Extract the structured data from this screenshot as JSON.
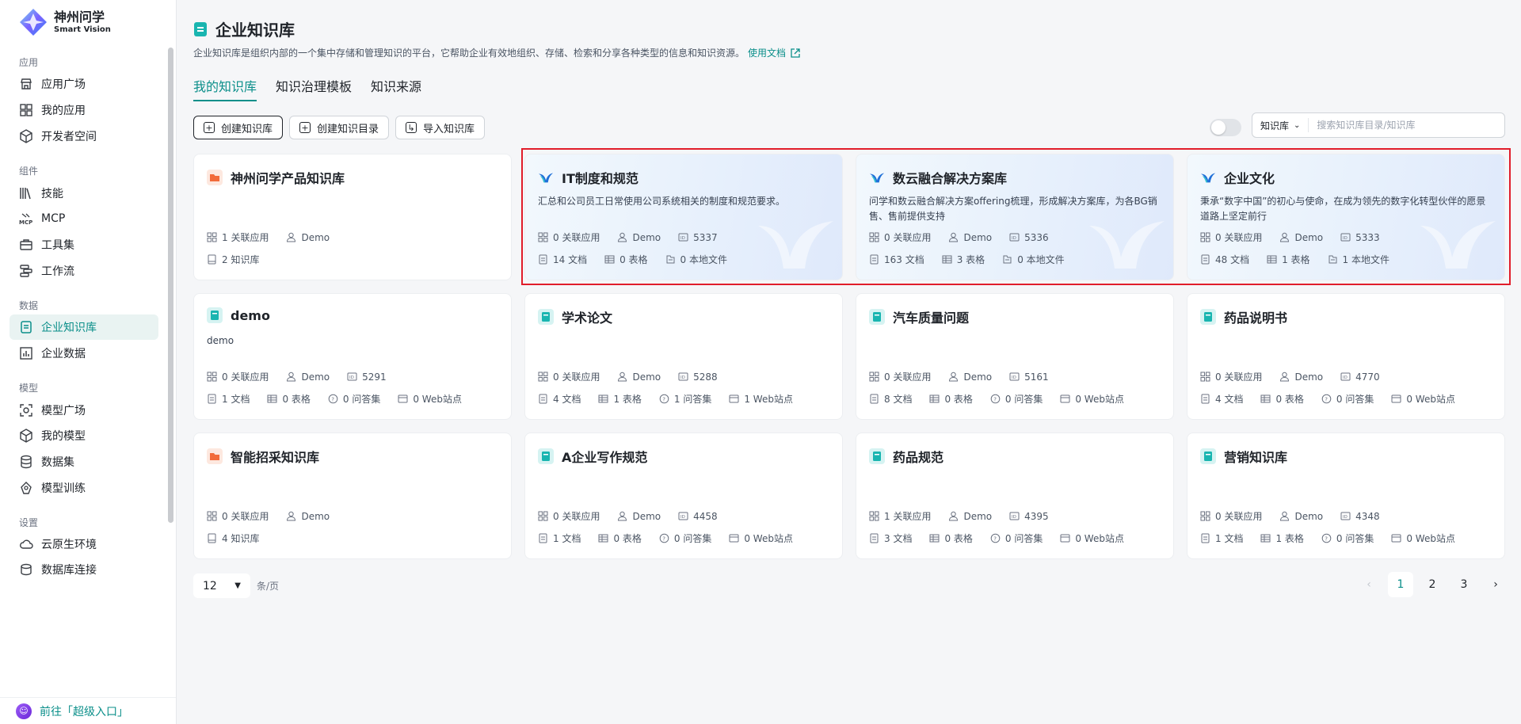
{
  "brand": {
    "name": "神州问学",
    "sub": "Smart Vision"
  },
  "sidebar": {
    "groups": [
      {
        "title": "应用",
        "items": [
          {
            "label": "应用广场",
            "icon": "store-icon"
          },
          {
            "label": "我的应用",
            "icon": "grid-icon"
          },
          {
            "label": "开发者空间",
            "icon": "cube-icon"
          }
        ]
      },
      {
        "title": "组件",
        "items": [
          {
            "label": "技能",
            "icon": "books-icon"
          },
          {
            "label": "MCP",
            "icon": "mcp-icon"
          },
          {
            "label": "工具集",
            "icon": "toolbox-icon"
          },
          {
            "label": "工作流",
            "icon": "workflow-icon"
          }
        ]
      },
      {
        "title": "数据",
        "items": [
          {
            "label": "企业知识库",
            "icon": "doc-icon"
          },
          {
            "label": "企业数据",
            "icon": "chart-icon"
          }
        ]
      },
      {
        "title": "模型",
        "items": [
          {
            "label": "模型广场",
            "icon": "scan-icon"
          },
          {
            "label": "我的模型",
            "icon": "box-icon"
          },
          {
            "label": "数据集",
            "icon": "database-icon"
          },
          {
            "label": "模型训练",
            "icon": "train-icon"
          }
        ]
      },
      {
        "title": "设置",
        "items": [
          {
            "label": "云原生环境",
            "icon": "cloud-icon"
          },
          {
            "label": "数据库连接",
            "icon": "db-link-icon"
          }
        ]
      }
    ],
    "active": "企业知识库",
    "bottom_link": "前往「超级入口」"
  },
  "header": {
    "title": "企业知识库",
    "description": "企业知识库是组织内部的一个集中存储和管理知识的平台，它帮助企业有效地组织、存储、检索和分享各种类型的信息和知识资源。",
    "doc_link": "使用文档"
  },
  "tabs": [
    "我的知识库",
    "知识治理模板",
    "知识来源"
  ],
  "actions": {
    "create_kb": "创建知识库",
    "create_dir": "创建知识目录",
    "import_kb": "导入知识库"
  },
  "search": {
    "scope": "知识库",
    "placeholder": "搜索知识库目录/知识库"
  },
  "cards": [
    {
      "title": "神州问学产品知识库",
      "type": "folder",
      "featured": false,
      "desc": "",
      "row1": [
        "1 关联应用",
        "Demo"
      ],
      "row2": [
        "2 知识库"
      ]
    },
    {
      "title": "IT制度和规范",
      "type": "brand",
      "featured": true,
      "desc": "汇总和公司员工日常使用公司系统相关的制度和规范要求。",
      "row1": [
        "0 关联应用",
        "Demo",
        "5337"
      ],
      "row2": [
        "14 文档",
        "0 表格",
        "0 本地文件"
      ]
    },
    {
      "title": "数云融合解决方案库",
      "type": "brand",
      "featured": true,
      "desc": "问学和数云融合解决方案offering梳理，形成解决方案库，为各BG销售、售前提供支持",
      "row1": [
        "0 关联应用",
        "Demo",
        "5336"
      ],
      "row2": [
        "163 文档",
        "3 表格",
        "0 本地文件"
      ]
    },
    {
      "title": "企业文化",
      "type": "brand",
      "featured": true,
      "desc": "秉承“数字中国”的初心与使命，在成为领先的数字化转型伙伴的愿景道路上坚定前行",
      "row1": [
        "0 关联应用",
        "Demo",
        "5333"
      ],
      "row2": [
        "48 文档",
        "1 表格",
        "1 本地文件"
      ]
    },
    {
      "title": "demo",
      "type": "book",
      "featured": false,
      "desc": "demo",
      "row1": [
        "0 关联应用",
        "Demo",
        "5291"
      ],
      "row2": [
        "1 文档",
        "0 表格",
        "0 问答集",
        "0 Web站点"
      ]
    },
    {
      "title": "学术论文",
      "type": "book",
      "featured": false,
      "desc": "",
      "row1": [
        "0 关联应用",
        "Demo",
        "5288"
      ],
      "row2": [
        "4 文档",
        "1 表格",
        "1 问答集",
        "1 Web站点"
      ]
    },
    {
      "title": "汽车质量问题",
      "type": "book",
      "featured": false,
      "desc": "",
      "row1": [
        "0 关联应用",
        "Demo",
        "5161"
      ],
      "row2": [
        "8 文档",
        "0 表格",
        "0 问答集",
        "0 Web站点"
      ]
    },
    {
      "title": "药品说明书",
      "type": "book",
      "featured": false,
      "desc": "",
      "row1": [
        "0 关联应用",
        "Demo",
        "4770"
      ],
      "row2": [
        "4 文档",
        "0 表格",
        "0 问答集",
        "0 Web站点"
      ]
    },
    {
      "title": "智能招采知识库",
      "type": "folder",
      "featured": false,
      "desc": "",
      "row1": [
        "0 关联应用",
        "Demo"
      ],
      "row2": [
        "4 知识库"
      ]
    },
    {
      "title": "A企业写作规范",
      "type": "book",
      "featured": false,
      "desc": "",
      "row1": [
        "0 关联应用",
        "Demo",
        "4458"
      ],
      "row2": [
        "1 文档",
        "0 表格",
        "0 问答集",
        "0 Web站点"
      ]
    },
    {
      "title": "药品规范",
      "type": "book",
      "featured": false,
      "desc": "",
      "row1": [
        "1 关联应用",
        "Demo",
        "4395"
      ],
      "row2": [
        "3 文档",
        "0 表格",
        "0 问答集",
        "0 Web站点"
      ]
    },
    {
      "title": "营销知识库",
      "type": "book",
      "featured": false,
      "desc": "",
      "row1": [
        "0 关联应用",
        "Demo",
        "4348"
      ],
      "row2": [
        "1 文档",
        "1 表格",
        "0 问答集",
        "0 Web站点"
      ]
    }
  ],
  "pagination": {
    "page_size": "12",
    "unit": "条/页",
    "pages": [
      "1",
      "2",
      "3"
    ],
    "current": "1"
  },
  "colors": {
    "accent": "#0b8f8a",
    "highlight": "#e11d2a",
    "folder": "#f26b3a",
    "book": "#19b5b0"
  }
}
